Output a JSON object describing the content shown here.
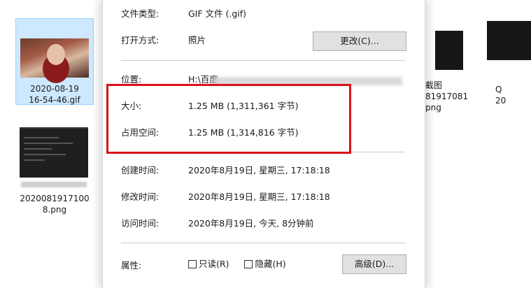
{
  "explorer": {
    "files": [
      {
        "name": "2020-08-19\n16-54-46.gif"
      },
      {
        "name": "2020081917100\n8.png"
      },
      {
        "name": "截图\n81917081\npng"
      },
      {
        "name": "Q\n20"
      }
    ]
  },
  "dialog": {
    "file_type": {
      "label": "文件类型:",
      "value": "GIF 文件 (.gif)"
    },
    "open_with": {
      "label": "打开方式:",
      "value": "照片",
      "button": "更改(C)..."
    },
    "location": {
      "label": "位置:",
      "value": "H:\\百度"
    },
    "size": {
      "label": "大小:",
      "value": "1.25 MB (1,311,361 字节)"
    },
    "size_on_disk": {
      "label": "占用空间:",
      "value": "1.25 MB (1,314,816 字节)"
    },
    "created": {
      "label": "创建时间:",
      "value": "2020年8月19日, 星期三, 17:18:18"
    },
    "modified": {
      "label": "修改时间:",
      "value": "2020年8月19日, 星期三, 17:18:18"
    },
    "accessed": {
      "label": "访问时间:",
      "value": "2020年8月19日, 今天, 8分钟前"
    },
    "attributes": {
      "label": "属性:",
      "readonly": "只读(R)",
      "hidden": "隐藏(H)",
      "advanced_button": "高级(D)..."
    }
  },
  "colors": {
    "highlight": "#d9121a",
    "selection": "#cde8ff"
  }
}
